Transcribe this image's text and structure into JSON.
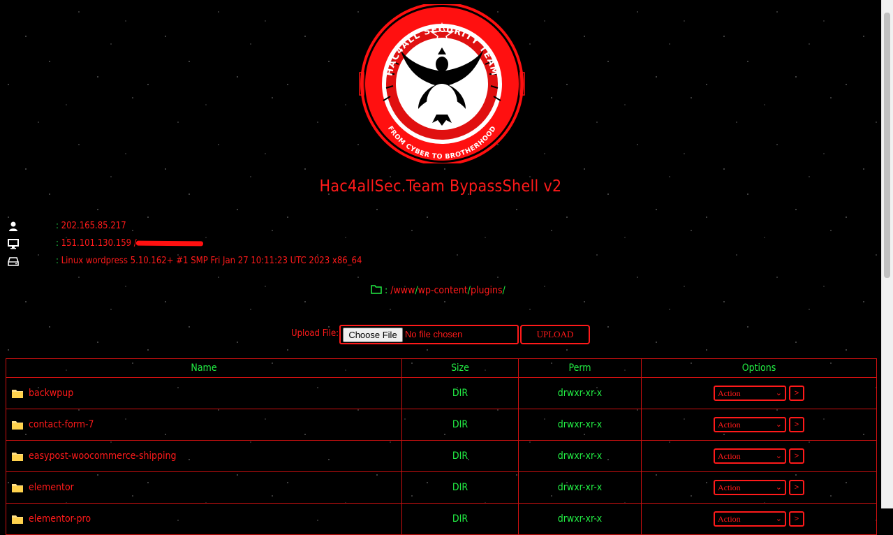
{
  "header": {
    "logo_top_text": "HAC4ALL SECURITY TEAM",
    "logo_bottom_text": "FROM CYBER TO BROTHERHOOD",
    "title": "Hac4allSec.Team BypassShell v2"
  },
  "info": {
    "user_ip": "202.165.85.217",
    "server_ip": "151.101.130.159 /",
    "system": "Linux wordpress 5.10.162+ #1 SMP Fri Jan 27 10:11:23 UTC 2023 x86_64",
    "separator": ":"
  },
  "path": {
    "separator": ":",
    "root": "/",
    "segments": [
      "www",
      "wp-content",
      "plugins"
    ],
    "slash": "/"
  },
  "upload": {
    "label": "Upload File:",
    "choose_label": "Choose File",
    "status": "No file chosen",
    "button_label": "UPLOAD"
  },
  "table": {
    "headers": [
      "Name",
      "Size",
      "Perm",
      "Options"
    ],
    "rows": [
      {
        "name": "backwpup",
        "size": "DIR",
        "perm": "drwxr-xr-x",
        "action": "Action",
        "go": ">"
      },
      {
        "name": "contact-form-7",
        "size": "DIR",
        "perm": "drwxr-xr-x",
        "action": "Action",
        "go": ">"
      },
      {
        "name": "easypost-woocommerce-shipping",
        "size": "DIR",
        "perm": "drwxr-xr-x",
        "action": "Action",
        "go": ">"
      },
      {
        "name": "elementor",
        "size": "DIR",
        "perm": "drwxr-xr-x",
        "action": "Action",
        "go": ">"
      },
      {
        "name": "elementor-pro",
        "size": "DIR",
        "perm": "drwxr-xr-x",
        "action": "Action",
        "go": ">"
      }
    ]
  },
  "colors": {
    "accent_red": "#ff1a1a",
    "accent_green": "#22ee44",
    "background": "#000000"
  }
}
